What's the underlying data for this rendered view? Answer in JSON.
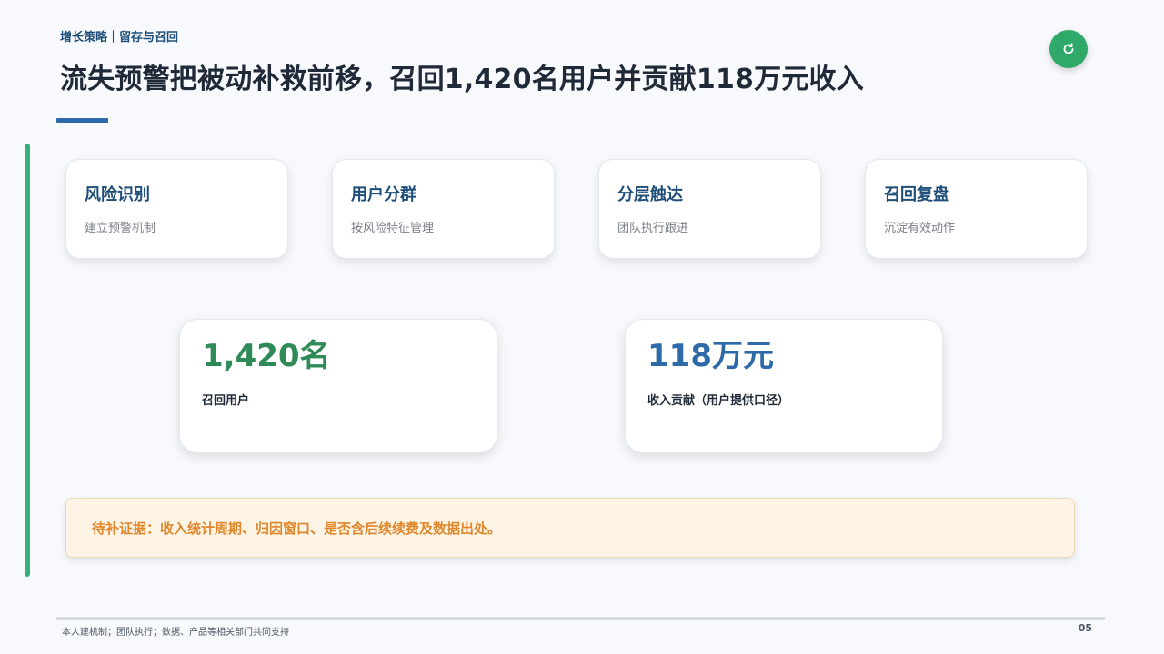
{
  "header": {
    "breadcrumb": "增长策略｜留存与召回",
    "title": "流失预警把被动补救前移，召回1,420名用户并贡献118万元收入"
  },
  "controls": {
    "refresh_icon": "refresh-icon"
  },
  "steps": [
    {
      "title": "风险识别",
      "desc": "建立预警机制"
    },
    {
      "title": "用户分群",
      "desc": "按风险特征管理"
    },
    {
      "title": "分层触达",
      "desc": "团队执行跟进"
    },
    {
      "title": "召回复盘",
      "desc": "沉淀有效动作"
    }
  ],
  "metrics": [
    {
      "value": "1,420名",
      "label": "召回用户",
      "color": "#2e8b57"
    },
    {
      "value": "118万元",
      "label": "收入贡献（用户提供口径）",
      "color": "#2e6aa8"
    }
  ],
  "pending": {
    "text": "待补证据：收入统计周期、归因窗口、是否含后续续费及数据出处。"
  },
  "footer": {
    "note": "本人建机制；团队执行；数据、产品等相关部门共同支持",
    "page": "05"
  },
  "colors": {
    "accent_green": "#35b07a",
    "accent_blue": "#2e6aa8",
    "warning_orange": "#e0872b"
  }
}
